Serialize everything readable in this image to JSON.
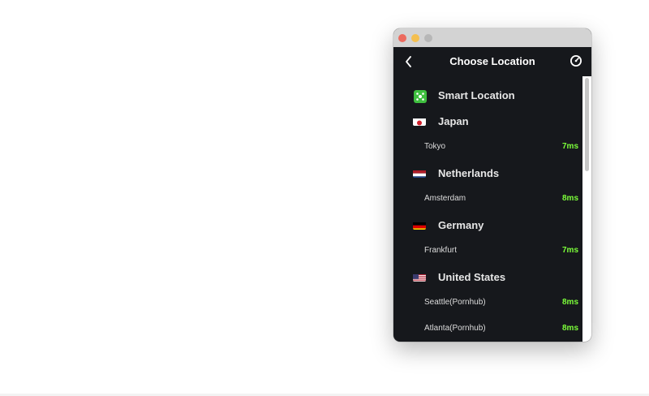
{
  "window": {
    "title": "Choose Location"
  },
  "header": {
    "back_icon": "chevron-left-icon",
    "speed_icon": "speedometer-icon"
  },
  "colors": {
    "background": "#16181c",
    "latency_green": "#7cff3a",
    "smart_icon_green": "#3fbf3f"
  },
  "locations": {
    "smart": {
      "label": "Smart Location",
      "icon": "smart-location-icon"
    },
    "japan": {
      "label": "Japan",
      "flag": "japan-flag-icon",
      "cities": [
        {
          "name": "Tokyo",
          "latency": "7ms"
        }
      ]
    },
    "netherlands": {
      "label": "Netherlands",
      "flag": "netherlands-flag-icon",
      "cities": [
        {
          "name": "Amsterdam",
          "latency": "8ms"
        }
      ]
    },
    "germany": {
      "label": "Germany",
      "flag": "germany-flag-icon",
      "cities": [
        {
          "name": "Frankfurt",
          "latency": "7ms"
        }
      ]
    },
    "us": {
      "label": "United States",
      "flag": "us-flag-icon",
      "cities": [
        {
          "name": "Seattle(Pornhub)",
          "latency": "8ms"
        },
        {
          "name": "Atlanta(Pornhub)",
          "latency": "8ms"
        }
      ]
    }
  }
}
